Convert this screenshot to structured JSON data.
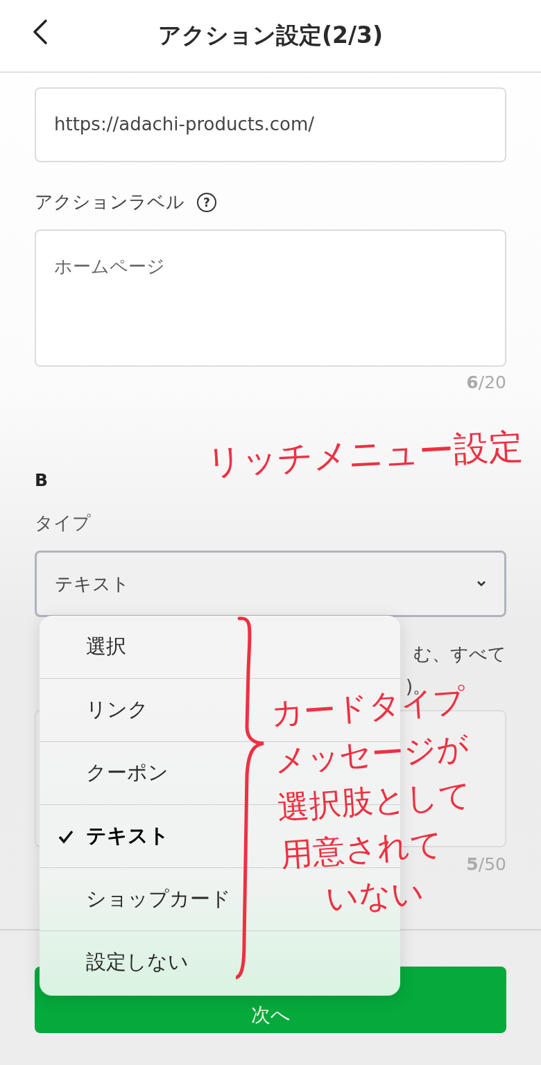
{
  "header": {
    "title": "アクション設定(2/3)"
  },
  "url_field": {
    "value": "https://adachi-products.com/"
  },
  "action_label": {
    "label": "アクションラベル",
    "help": "?",
    "value": "ホームページ",
    "counter": "**6**/20"
  },
  "section": "B",
  "type_field": {
    "label": "タイプ",
    "value": "テキスト"
  },
  "hint": [
    "む、すべて",
    ")。"
  ],
  "message_field": {
    "counter": "**5**/50"
  },
  "next_button": "次へ",
  "dropdown": {
    "options": [
      {
        "label": "選択",
        "selected": false
      },
      {
        "label": "リンク",
        "selected": false
      },
      {
        "label": "クーポン",
        "selected": false
      },
      {
        "label": "テキスト",
        "selected": true
      },
      {
        "label": "ショップカード",
        "selected": false
      },
      {
        "label": "設定しない",
        "selected": false
      }
    ]
  },
  "annotations": [
    {
      "kind": "title",
      "lines": [
        "リッチメニュー設定"
      ]
    },
    {
      "kind": "note",
      "lines": [
        "カードタイプ",
        "メッセージが",
        "選択肢として",
        "用意されて",
        "いない"
      ]
    }
  ]
}
